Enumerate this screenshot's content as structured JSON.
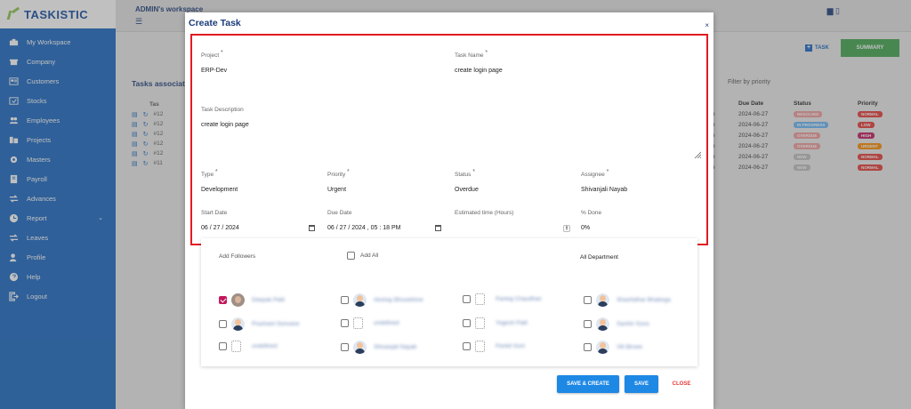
{
  "brand": {
    "name": "TASKISTIC"
  },
  "sidebar": {
    "items": [
      {
        "label": "My Workspace",
        "icon": "briefcase-icon"
      },
      {
        "label": "Company",
        "icon": "company-icon"
      },
      {
        "label": "Customers",
        "icon": "customers-icon"
      },
      {
        "label": "Stocks",
        "icon": "stocks-icon"
      },
      {
        "label": "Employees",
        "icon": "employees-icon"
      },
      {
        "label": "Projects",
        "icon": "projects-icon"
      },
      {
        "label": "Masters",
        "icon": "gear-icon"
      },
      {
        "label": "Payroll",
        "icon": "payroll-icon"
      },
      {
        "label": "Advances",
        "icon": "transfer-icon"
      },
      {
        "label": "Report",
        "icon": "report-icon",
        "has_caret": true
      },
      {
        "label": "Leaves",
        "icon": "transfer-icon"
      },
      {
        "label": "Profile",
        "icon": "profile-icon"
      },
      {
        "label": "Help",
        "icon": "help-icon"
      },
      {
        "label": "Logout",
        "icon": "logout-icon"
      }
    ]
  },
  "background": {
    "workspace_title": "ADMIN's workspace",
    "task_button": "TASK",
    "summary_button": "SUMMARY",
    "tasks_title": "Tasks associate",
    "filter_label": "Filter by priority",
    "left_header": "Tas",
    "left_rows": [
      "#12",
      "#12",
      "#12",
      "#12",
      "#12",
      "#11"
    ],
    "table": {
      "headers": [
        "",
        "Due Date",
        "Status",
        "Priority"
      ],
      "rows": [
        {
          "c": "e",
          "due": "2024-06-27",
          "status": "RESOLVED",
          "status_color": "#ef9a9a",
          "priority": "NORMAL",
          "priority_color": "#e53935"
        },
        {
          "c": "e",
          "due": "2024-06-27",
          "status": "IN PROGRESS",
          "status_color": "#64b5f6",
          "priority": "LOW",
          "priority_color": "#e53935"
        },
        {
          "c": "e",
          "due": "2024-06-27",
          "status": "OVERDUE",
          "status_color": "#ef9a9a",
          "priority": "HIGH",
          "priority_color": "#c2185b"
        },
        {
          "c": "e",
          "due": "2024-06-27",
          "status": "OVERDUE",
          "status_color": "#ef9a9a",
          "priority": "URGENT",
          "priority_color": "#fb8c00"
        },
        {
          "c": "e",
          "due": "2024-06-27",
          "status": "NEW",
          "status_color": "#bdbdbd",
          "priority": "NORMAL",
          "priority_color": "#e53935"
        },
        {
          "c": "e",
          "due": "2024-06-27",
          "status": "NEW",
          "status_color": "#bdbdbd",
          "priority": "NORMAL",
          "priority_color": "#e53935"
        }
      ]
    }
  },
  "modal": {
    "title": "Create Task",
    "close_symbol": "×",
    "fields": {
      "project": {
        "label": "Project",
        "value": "ERP-Dev",
        "required": "*"
      },
      "task_name": {
        "label": "Task Name",
        "value": "create login page",
        "required": "*"
      },
      "description": {
        "label": "Task Description",
        "value": "create login page"
      },
      "type": {
        "label": "Type",
        "value": "Development",
        "required": "*"
      },
      "priority": {
        "label": "Priority",
        "value": "Urgent",
        "required": "*"
      },
      "status": {
        "label": "Status",
        "value": "Overdue",
        "required": "*"
      },
      "assignee": {
        "label": "Assignee",
        "value": "Shivanjali Nayab",
        "required": "*"
      },
      "start_date": {
        "label": "Start Date",
        "value": "06 / 27 / 2024"
      },
      "due_date": {
        "label": "Due Date",
        "value": "06 / 27 / 2024 , 05 : 18  PM"
      },
      "estimated": {
        "label": "Estimated time (Hours)",
        "value": ""
      },
      "done": {
        "label": "% Done",
        "value": "0%"
      }
    },
    "followers": {
      "add_followers_label": "Add Followers",
      "add_all_label": "Add All",
      "department_label": "All Department",
      "people": [
        {
          "name": "Deepak Patil",
          "avatar": "photo",
          "checked": true
        },
        {
          "name": "Akshay Bhosekhne",
          "avatar": "suit",
          "checked": false
        },
        {
          "name": "Pankaj Chaudhari",
          "avatar": "blank",
          "checked": false
        },
        {
          "name": "Shashidhar Bhalerga",
          "avatar": "suit",
          "checked": false
        },
        {
          "name": "Prashant Sonvane",
          "avatar": "suit",
          "checked": false
        },
        {
          "name": "undefined",
          "avatar": "blank",
          "checked": false
        },
        {
          "name": "Yogesh Patil",
          "avatar": "blank",
          "checked": false
        },
        {
          "name": "Sachin Sono",
          "avatar": "suit",
          "checked": false
        },
        {
          "name": "undefined",
          "avatar": "blank",
          "checked": false
        },
        {
          "name": "Shivanjali Nayab",
          "avatar": "suit",
          "checked": false
        },
        {
          "name": "Pankit Soni",
          "avatar": "blank",
          "checked": false
        },
        {
          "name": "Viti Birsee",
          "avatar": "suit",
          "checked": false
        }
      ]
    },
    "buttons": {
      "save_create": "SAVE & CREATE",
      "save": "SAVE",
      "close": "CLOSE"
    }
  },
  "colors": {
    "sidebar": "#1565c0",
    "accent": "#1e88e5",
    "highlight_border": "#e21b23",
    "summary": "#3fa34d"
  }
}
